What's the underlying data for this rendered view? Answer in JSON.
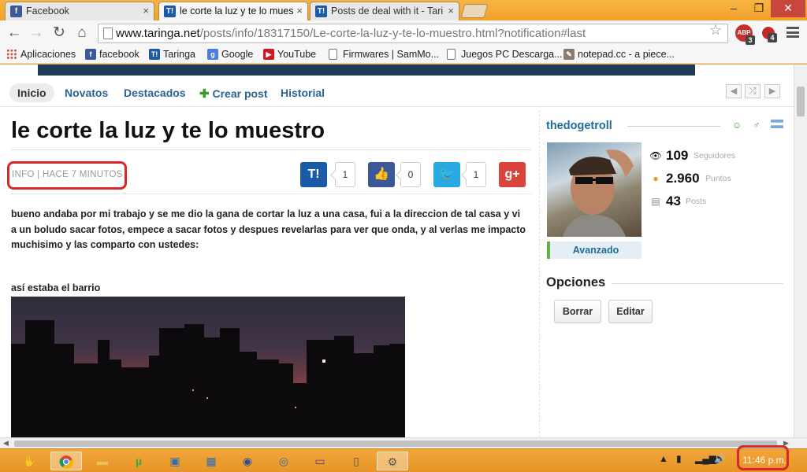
{
  "browser": {
    "tabs": [
      {
        "title": "Facebook",
        "icon": "facebook-icon"
      },
      {
        "title": "le corte la luz y te lo mues",
        "icon": "taringa-icon"
      },
      {
        "title": "Posts de deal with it - Tari",
        "icon": "taringa-icon"
      }
    ],
    "tab_close_glyph": "×",
    "window_controls": {
      "minimize": "–",
      "maximize": "❐",
      "close": "✕"
    },
    "nav": {
      "back": "←",
      "forward": "→",
      "reload": "↻",
      "home": "⌂"
    },
    "url": {
      "host": "www.taringa.net",
      "path": "/posts/info/18317150/Le-corte-la-luz-y-te-lo-muestro.html?notification#last"
    },
    "star": "☆",
    "extensions": [
      {
        "name": "adblock-plus-extension-icon",
        "label": "ABP",
        "badge": "3",
        "color": "#c4302b"
      },
      {
        "name": "notification-extension-icon",
        "label": "",
        "badge": "4",
        "color": "#c62828"
      }
    ],
    "bookmarks": [
      {
        "label": "Aplicaciones",
        "icon": "apps-grid-icon"
      },
      {
        "label": "facebook",
        "icon": "facebook-icon"
      },
      {
        "label": "Taringa",
        "icon": "taringa-icon"
      },
      {
        "label": "Google",
        "icon": "google-icon"
      },
      {
        "label": "YouTube",
        "icon": "youtube-icon"
      },
      {
        "label": "Firmwares | SamMo...",
        "icon": "page-icon"
      },
      {
        "label": "Juegos PC Descarga...",
        "icon": "page-icon"
      },
      {
        "label": "notepad.cc - a piece...",
        "icon": "notepad-icon"
      }
    ]
  },
  "site": {
    "nav": [
      {
        "label": "Inicio",
        "active": true
      },
      {
        "label": "Novatos",
        "active": false
      },
      {
        "label": "Destacados",
        "active": false
      },
      {
        "label": "Crear post",
        "active": false,
        "icon": "plus-icon"
      },
      {
        "label": "Historial",
        "active": false
      }
    ],
    "pager": {
      "prev": "◀",
      "random": "⤮",
      "next": "▶"
    }
  },
  "post": {
    "title": "le corte la luz y te lo muestro",
    "meta": "INFO | HACE 7 MINUTOS",
    "share": [
      {
        "name": "taringa-share",
        "glyph": "T!",
        "count": "1",
        "color": "#1b5aa6"
      },
      {
        "name": "like",
        "glyph": "👍",
        "count": "0",
        "color": "#3b5998"
      },
      {
        "name": "twitter-share",
        "glyph": "🐦",
        "count": "1",
        "color": "#29a9e1"
      },
      {
        "name": "google-plus-share",
        "glyph": "g+",
        "count": "",
        "color": "#d9453d"
      }
    ],
    "body": "bueno andaba por mi trabajo y se me dio la gana de cortar la luz a una casa, fui a la direccion de tal casa y vi a un boludo sacar fotos, empece a sacar fotos y despues revelarlas para ver que onda, y al verlas me impacto muchisimo y las comparto con ustedes:",
    "caption": "así estaba el barrio",
    "image": "night-city-skyline-photo"
  },
  "author": {
    "username": "thedogetroll",
    "rank": "Avanzado",
    "stats": [
      {
        "value": "109",
        "label": "Seguidores",
        "icon": "eye-icon"
      },
      {
        "value": "2.960",
        "label": "Puntos",
        "icon": "coin-icon"
      },
      {
        "value": "43",
        "label": "Posts",
        "icon": "document-icon"
      }
    ]
  },
  "options": {
    "title": "Opciones",
    "buttons": [
      "Borrar",
      "Editar"
    ]
  },
  "taskbar": {
    "clock": "11:46 p.m.",
    "highlight_color": "#d9262b"
  }
}
